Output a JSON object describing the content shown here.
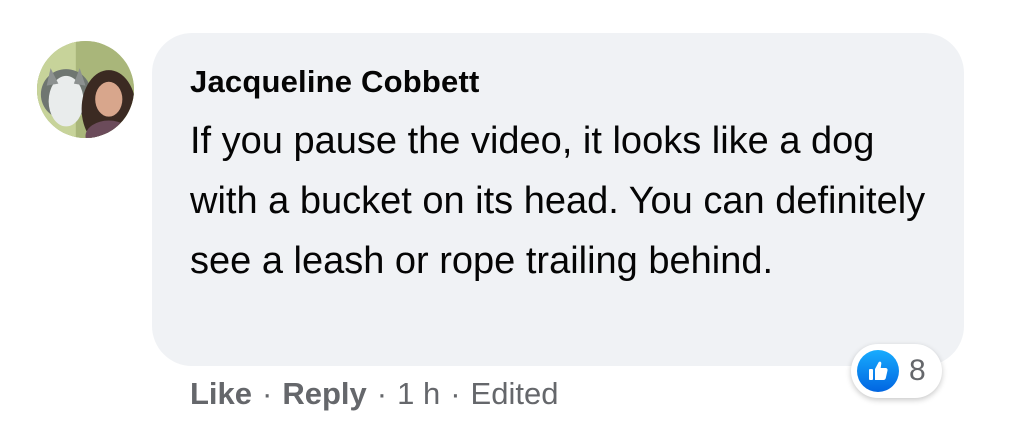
{
  "comment": {
    "author": "Jacqueline Cobbett",
    "text": "If you pause the video, it looks like a dog with a bucket on its head. You can definitely see a leash or rope trailing behind.",
    "avatar_icon": "profile-photo",
    "bubble_color": "#f0f2f5"
  },
  "reactions": {
    "icon": "like-icon",
    "count": "8",
    "badge_color": "#1877f2"
  },
  "actions": {
    "like_label": "Like",
    "reply_label": "Reply",
    "separator": "·",
    "timestamp": "1 h",
    "edited_label": "Edited",
    "text_color": "#65676b"
  }
}
